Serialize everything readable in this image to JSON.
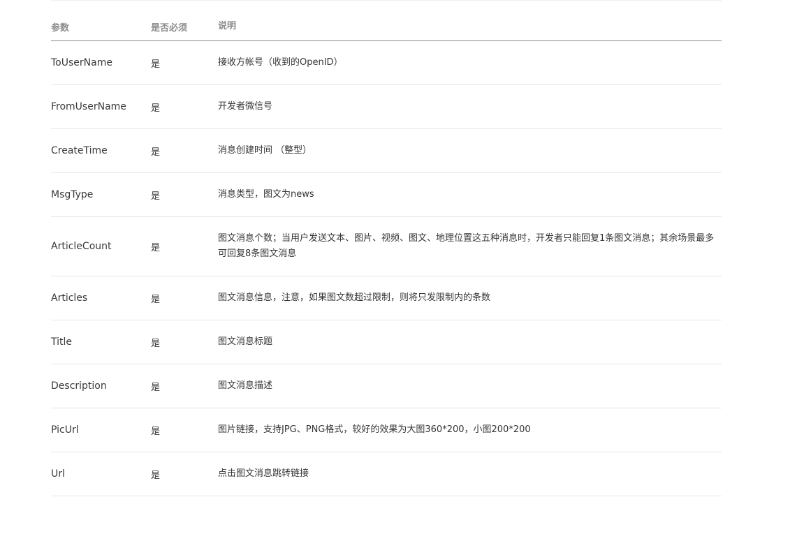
{
  "table": {
    "headers": {
      "param": "参数",
      "required": "是否必须",
      "description": "说明"
    },
    "rows": [
      {
        "param": "ToUserName",
        "required": "是",
        "description": "接收方帐号（收到的OpenID）"
      },
      {
        "param": "FromUserName",
        "required": "是",
        "description": "开发者微信号"
      },
      {
        "param": "CreateTime",
        "required": "是",
        "description": "消息创建时间 （整型）"
      },
      {
        "param": "MsgType",
        "required": "是",
        "description": "消息类型，图文为news"
      },
      {
        "param": "ArticleCount",
        "required": "是",
        "description": "图文消息个数；当用户发送文本、图片、视频、图文、地理位置这五种消息时，开发者只能回复1条图文消息；其余场景最多可回复8条图文消息"
      },
      {
        "param": "Articles",
        "required": "是",
        "description": "图文消息信息，注意，如果图文数超过限制，则将只发限制内的条数"
      },
      {
        "param": "Title",
        "required": "是",
        "description": "图文消息标题"
      },
      {
        "param": "Description",
        "required": "是",
        "description": "图文消息描述"
      },
      {
        "param": "PicUrl",
        "required": "是",
        "description": "图片链接，支持JPG、PNG格式，较好的效果为大图360*200，小图200*200"
      },
      {
        "param": "Url",
        "required": "是",
        "description": "点击图文消息跳转链接"
      }
    ]
  }
}
